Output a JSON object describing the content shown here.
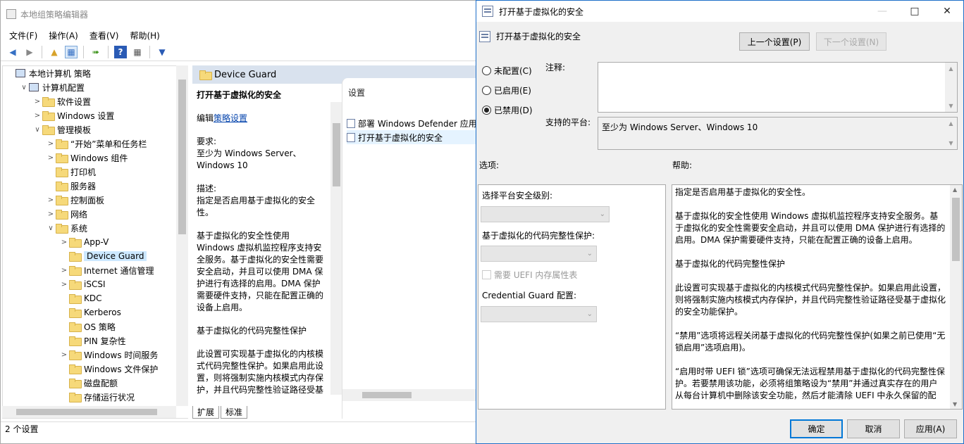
{
  "main_window": {
    "title": "本地组策略编辑器",
    "menu": [
      "文件(F)",
      "操作(A)",
      "查看(V)",
      "帮助(H)"
    ],
    "tree": [
      {
        "label": "本地计算机 策略",
        "level": 0,
        "chevron": "",
        "icon": "computer"
      },
      {
        "label": "计算机配置",
        "level": 1,
        "chevron": "∨",
        "icon": "computer"
      },
      {
        "label": "软件设置",
        "level": 2,
        "chevron": ">",
        "icon": "folder"
      },
      {
        "label": "Windows 设置",
        "level": 2,
        "chevron": ">",
        "icon": "folder"
      },
      {
        "label": "管理模板",
        "level": 2,
        "chevron": "∨",
        "icon": "folder"
      },
      {
        "label": "“开始”菜单和任务栏",
        "level": 3,
        "chevron": ">",
        "icon": "folder"
      },
      {
        "label": "Windows 组件",
        "level": 3,
        "chevron": ">",
        "icon": "folder"
      },
      {
        "label": "打印机",
        "level": 3,
        "chevron": "",
        "icon": "folder"
      },
      {
        "label": "服务器",
        "level": 3,
        "chevron": "",
        "icon": "folder"
      },
      {
        "label": "控制面板",
        "level": 3,
        "chevron": ">",
        "icon": "folder"
      },
      {
        "label": "网络",
        "level": 3,
        "chevron": ">",
        "icon": "folder"
      },
      {
        "label": "系统",
        "level": 3,
        "chevron": "∨",
        "icon": "folder"
      },
      {
        "label": "App-V",
        "level": 4,
        "chevron": ">",
        "icon": "folder"
      },
      {
        "label": "Device Guard",
        "level": 4,
        "chevron": "",
        "icon": "folder",
        "selected": true
      },
      {
        "label": "Internet 通信管理",
        "level": 4,
        "chevron": ">",
        "icon": "folder"
      },
      {
        "label": "iSCSI",
        "level": 4,
        "chevron": ">",
        "icon": "folder"
      },
      {
        "label": "KDC",
        "level": 4,
        "chevron": "",
        "icon": "folder"
      },
      {
        "label": "Kerberos",
        "level": 4,
        "chevron": "",
        "icon": "folder"
      },
      {
        "label": "OS 策略",
        "level": 4,
        "chevron": "",
        "icon": "folder"
      },
      {
        "label": "PIN 复杂性",
        "level": 4,
        "chevron": "",
        "icon": "folder"
      },
      {
        "label": "Windows 时间服务",
        "level": 4,
        "chevron": ">",
        "icon": "folder"
      },
      {
        "label": "Windows 文件保护",
        "level": 4,
        "chevron": "",
        "icon": "folder"
      },
      {
        "label": "磁盘配额",
        "level": 4,
        "chevron": "",
        "icon": "folder"
      },
      {
        "label": "存储运行状况",
        "level": 4,
        "chevron": "",
        "icon": "folder"
      }
    ],
    "middle": {
      "header": "Device Guard",
      "setting_title": "打开基于虚拟化的安全",
      "edit_prefix": "编辑",
      "edit_link": "策略设置",
      "requirements_label": "要求:",
      "requirements": "至少为 Windows Server、Windows 10",
      "description_label": "描述:",
      "description": "指定是否启用基于虚拟化的安全性。",
      "para1": "基于虚拟化的安全性使用 Windows 虚拟机监控程序支持安全服务。基于虚拟化的安全性需要安全启动，并且可以使用 DMA 保护进行有选择的启用。DMA 保护需要硬件支持，只能在配置正确的设备上启用。",
      "para2": "基于虚拟化的代码完整性保护",
      "para3": "此设置可实现基于虚拟化的内核模式代码完整性保护。如果启用此设置，则将强制实施内核模式内存保护，并且代码完整性验证路径受基"
    },
    "list": {
      "header": "设置",
      "items": [
        "部署 Windows Defender 应用",
        "打开基于虚拟化的安全"
      ]
    },
    "tabs": [
      "扩展",
      "标准"
    ],
    "status": "2 个设置"
  },
  "dialog": {
    "title": "打开基于虚拟化的安全",
    "heading": "打开基于虚拟化的安全",
    "prev_button": "上一个设置(P)",
    "next_button": "下一个设置(N)",
    "radio_not_configured": "未配置(C)",
    "radio_enabled": "已启用(E)",
    "radio_disabled": "已禁用(D)",
    "comment_label": "注释:",
    "platform_label": "支持的平台:",
    "platform_value": "至少为 Windows Server、Windows 10",
    "options_label": "选项:",
    "help_label": "帮助:",
    "opt_platform_level": "选择平台安全级别:",
    "opt_code_integrity": "基于虚拟化的代码完整性保护:",
    "opt_uefi_checkbox": "需要 UEFI 内存属性表",
    "opt_credential_guard": "Credential Guard 配置:",
    "help_paragraphs": [
      "指定是否启用基于虚拟化的安全性。",
      "基于虚拟化的安全性使用 Windows 虚拟机监控程序支持安全服务。基于虚拟化的安全性需要安全启动，并且可以使用 DMA 保护进行有选择的启用。DMA 保护需要硬件支持，只能在配置正确的设备上启用。",
      "基于虚拟化的代码完整性保护",
      "此设置可实现基于虚拟化的内核模式代码完整性保护。如果启用此设置，则将强制实施内核模式内存保护，并且代码完整性验证路径受基于虚拟化的安全功能保护。",
      "“禁用”选项将远程关闭基于虚拟化的代码完整性保护(如果之前已使用“无锁启用”选项启用)。",
      "“启用时带 UEFI 锁”选项可确保无法远程禁用基于虚拟化的代码完整性保护。若要禁用该功能，必须将组策略设为“禁用”并通过真实存在的用户从每台计算机中删除该安全功能，然后才能清除 UEFI 中永久保留的配"
    ],
    "ok_button": "确定",
    "cancel_button": "取消",
    "apply_button": "应用(A)"
  }
}
